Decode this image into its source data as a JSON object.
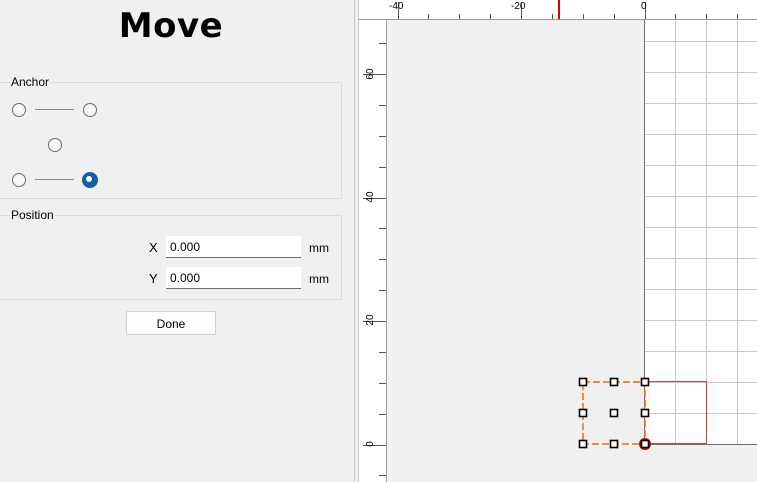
{
  "panel": {
    "title": "Move",
    "anchor_group": {
      "label": "Anchor",
      "options": [
        {
          "id": "top-left",
          "checked": false
        },
        {
          "id": "top-right",
          "checked": false
        },
        {
          "id": "center",
          "checked": false
        },
        {
          "id": "bottom-left",
          "checked": false
        },
        {
          "id": "bottom-right",
          "checked": true
        }
      ]
    },
    "position_group": {
      "label": "Position",
      "x_label": "X",
      "x_value": "0.000",
      "y_label": "Y",
      "y_value": "0.000",
      "unit": "mm"
    },
    "done_label": "Done"
  },
  "canvas": {
    "ruler_top_labels": [
      "-40",
      "-20",
      "0"
    ],
    "ruler_left_labels": [
      "60",
      "40",
      "20",
      "0"
    ],
    "colors": {
      "selection": "#e8710a",
      "design_outline": "#e23b3b",
      "cursor_marker": "#e00000",
      "grid": "#c8c8c8",
      "workspace": "#ffffff",
      "outside": "#f0f0f0"
    }
  }
}
